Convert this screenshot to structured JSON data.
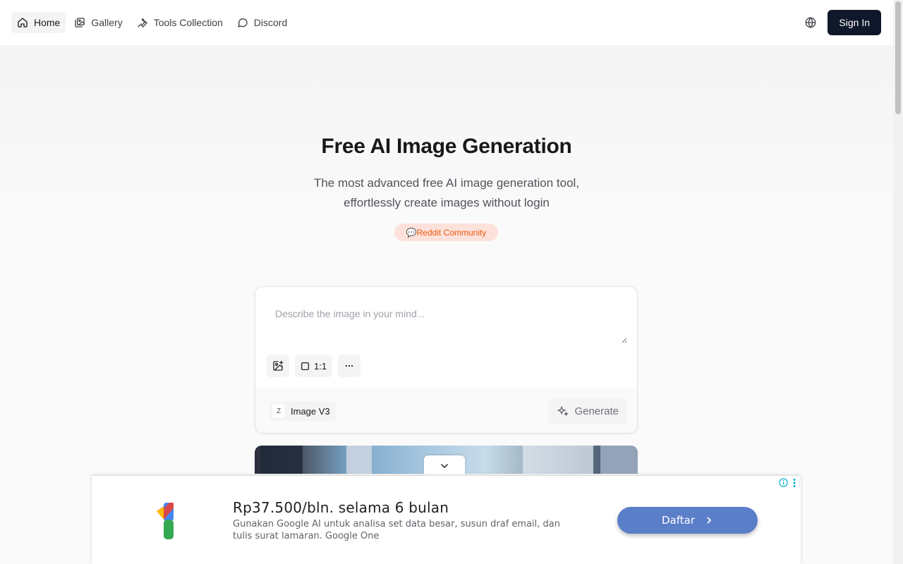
{
  "nav": {
    "items": [
      {
        "label": "Home",
        "icon": "home-icon",
        "active": true
      },
      {
        "label": "Gallery",
        "icon": "gallery-icon",
        "active": false
      },
      {
        "label": "Tools Collection",
        "icon": "wrench-icon",
        "active": false
      },
      {
        "label": "Discord",
        "icon": "chat-bubble-icon",
        "active": false
      }
    ],
    "language_icon": "globe-icon",
    "sign_in_label": "Sign In"
  },
  "hero": {
    "title": "Free AI Image Generation",
    "subtitle": "The most advanced free AI image generation tool, effortlessly create images without login",
    "badge_emoji": "💬",
    "badge_label": "Reddit Community"
  },
  "prompt_card": {
    "placeholder": "Describe the image in your mind...",
    "value": "",
    "aspect_ratio_label": "1:1",
    "model_initial": "Z",
    "model_label": "Image V3",
    "generate_label": "Generate"
  },
  "ad": {
    "title": "Rp37.500/bln. selama 6 bulan",
    "description": "Gunakan Google AI untuk analisa set data besar, susun draf email, dan tulis surat lamaran. Google One",
    "cta_label": "Daftar",
    "colors": {
      "cta": "#5b7ec8",
      "logo_red": "#ea4335",
      "logo_yellow": "#fbbc04",
      "logo_green": "#34a853",
      "logo_blue": "#4285f4"
    }
  },
  "colors": {
    "sign_in_bg": "#0f172a",
    "badge_bg": "#fde2dc",
    "badge_text": "#ea580c"
  }
}
